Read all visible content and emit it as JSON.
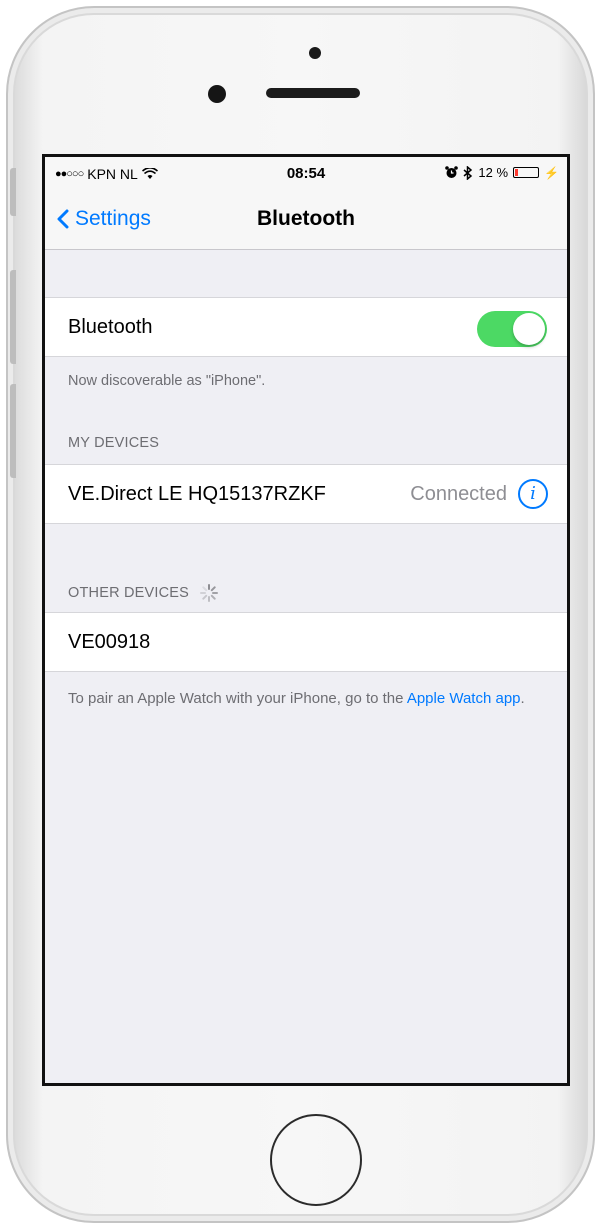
{
  "status_bar": {
    "carrier": "KPN NL",
    "time": "08:54",
    "battery": "12 %",
    "battery_level": 0.12
  },
  "nav": {
    "back_label": "Settings",
    "title": "Bluetooth"
  },
  "bluetooth": {
    "label": "Bluetooth",
    "enabled": true,
    "discoverable_text": "Now discoverable as \"iPhone\"."
  },
  "my_devices": {
    "header": "MY DEVICES",
    "items": [
      {
        "name": "VE.Direct LE HQ15137RZKF",
        "status": "Connected",
        "info_icon": "i"
      }
    ]
  },
  "other_devices": {
    "header": "OTHER DEVICES",
    "items": [
      {
        "name": "VE00918"
      }
    ]
  },
  "pair_note": {
    "text": "To pair an Apple Watch with your iPhone, go to the ",
    "link": "Apple Watch app",
    "suffix": "."
  },
  "colors": {
    "accent": "#007aff",
    "switch_on": "#4cd964",
    "battery_low": "#ff3b30",
    "background": "#efeff4"
  }
}
